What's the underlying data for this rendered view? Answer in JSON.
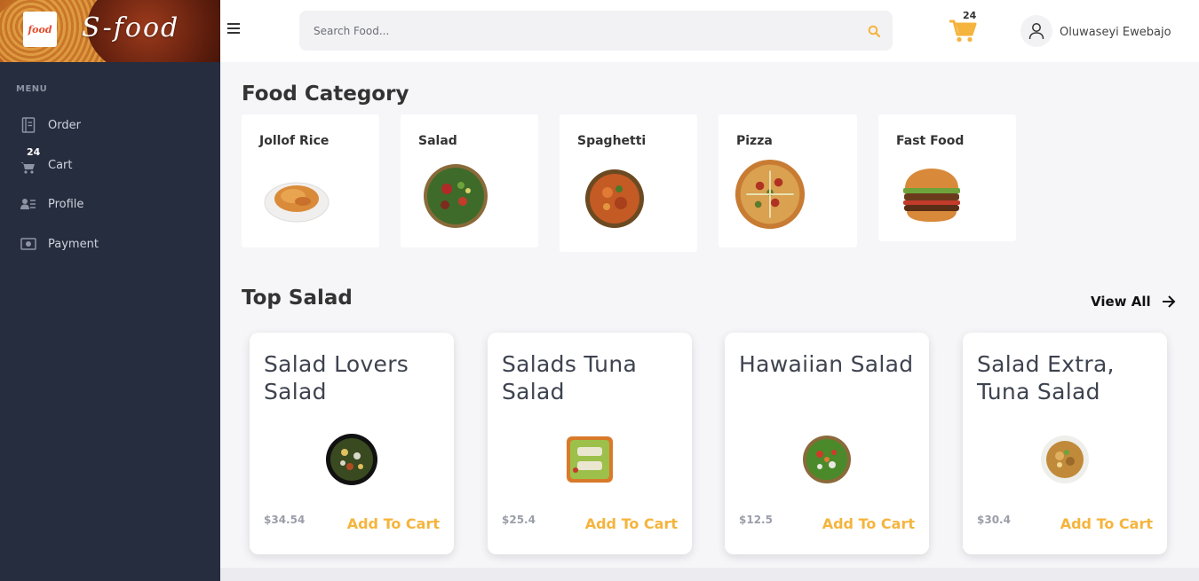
{
  "brand": {
    "logo_text": "food",
    "script_text": "S-food"
  },
  "sidebar": {
    "menu_title": "MENU",
    "items": [
      {
        "label": "Order",
        "icon": "order-icon"
      },
      {
        "label": "Cart",
        "icon": "cart-icon",
        "badge": "24"
      },
      {
        "label": "Profile",
        "icon": "profile-icon"
      },
      {
        "label": "Payment",
        "icon": "payment-icon"
      }
    ]
  },
  "header": {
    "search_placeholder": "Search Food...",
    "cart_count": "24",
    "username": "Oluwaseyi Ewebajo"
  },
  "categories": {
    "title": "Food Category",
    "items": [
      {
        "name": "Jollof Rice"
      },
      {
        "name": "Salad"
      },
      {
        "name": "Spaghetti"
      },
      {
        "name": "Pizza"
      },
      {
        "name": "Fast Food"
      }
    ]
  },
  "top_salad": {
    "title": "Top Salad",
    "view_all": "View All",
    "products": [
      {
        "name": "Salad Lovers Salad",
        "price": "$34.54",
        "add_label": "Add To Cart"
      },
      {
        "name": "Salads Tuna Salad",
        "price": "$25.4",
        "add_label": "Add To Cart"
      },
      {
        "name": "Hawaiian Salad",
        "price": "$12.5",
        "add_label": "Add To Cart"
      },
      {
        "name": "Salad Extra, Tuna Salad",
        "price": "$30.4",
        "add_label": "Add To Cart"
      }
    ]
  },
  "colors": {
    "accent": "#f5b43d",
    "sidebar_bg": "#262d3e",
    "page_bg": "#f6f6f9"
  }
}
